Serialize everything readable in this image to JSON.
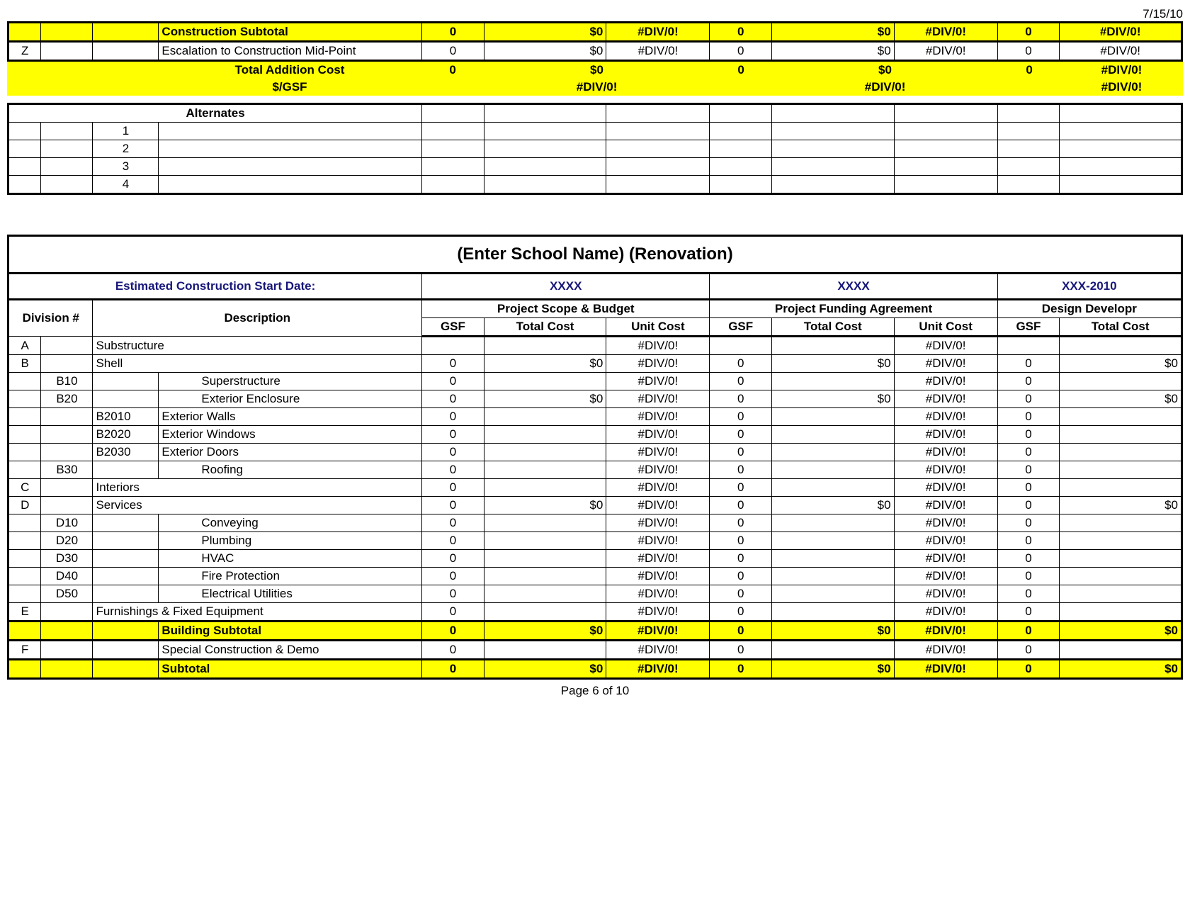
{
  "header_date": "7/15/10",
  "top": {
    "construction_subtotal": {
      "label": "Construction Subtotal",
      "v": [
        "0",
        "$0",
        "#DIV/0!",
        "0",
        "$0",
        "#DIV/0!",
        "0",
        "#DIV/0!"
      ]
    },
    "escalation": {
      "code": "Z",
      "label": "Escalation to Construction Mid-Point",
      "v": [
        "0",
        "$0",
        "#DIV/0!",
        "0",
        "$0",
        "#DIV/0!",
        "0",
        "#DIV/0!"
      ]
    },
    "total_addition": {
      "label": "Total Addition Cost",
      "v": [
        "0",
        "$0",
        "0",
        "$0",
        "0",
        "#DIV/0!"
      ]
    },
    "per_gsf": {
      "label": "$/GSF",
      "v": [
        "#DIV/0!",
        "#DIV/0!",
        "#DIV/0!"
      ]
    }
  },
  "alternates": {
    "header": "Alternates",
    "rows": [
      "1",
      "2",
      "3",
      "4"
    ]
  },
  "main": {
    "title": "(Enter School Name) (Renovation)",
    "start_label": "Estimated Construction Start Date:",
    "dates": [
      "XXXX",
      "XXXX",
      "XXX-2010"
    ],
    "groups": [
      "Project Scope & Budget",
      "Project Funding Agreement",
      "Design Developr"
    ],
    "cols": {
      "div": "Division #",
      "desc": "Description",
      "gsf": "GSF",
      "tc": "Total Cost",
      "uc": "Unit Cost"
    },
    "rows": [
      {
        "a": "A",
        "b": "",
        "c": "",
        "d": "Substructure",
        "ind": 0,
        "v": [
          "",
          "",
          "#DIV/0!",
          "",
          "",
          "#DIV/0!",
          "",
          ""
        ]
      },
      {
        "a": "B",
        "b": "",
        "c": "",
        "d": "Shell",
        "ind": 0,
        "v": [
          "0",
          "$0",
          "#DIV/0!",
          "0",
          "$0",
          "#DIV/0!",
          "0",
          "$0"
        ]
      },
      {
        "a": "",
        "b": "B10",
        "c": "",
        "d": "Superstructure",
        "ind": 2,
        "v": [
          "0",
          "",
          "#DIV/0!",
          "0",
          "",
          "#DIV/0!",
          "0",
          ""
        ]
      },
      {
        "a": "",
        "b": "B20",
        "c": "",
        "d": "Exterior Enclosure",
        "ind": 2,
        "v": [
          "0",
          "$0",
          "#DIV/0!",
          "0",
          "$0",
          "#DIV/0!",
          "0",
          "$0"
        ]
      },
      {
        "a": "",
        "b": "",
        "c": "B2010",
        "d": "Exterior Walls",
        "ind": 1,
        "v": [
          "0",
          "",
          "#DIV/0!",
          "0",
          "",
          "#DIV/0!",
          "0",
          ""
        ]
      },
      {
        "a": "",
        "b": "",
        "c": "B2020",
        "d": "Exterior Windows",
        "ind": 1,
        "v": [
          "0",
          "",
          "#DIV/0!",
          "0",
          "",
          "#DIV/0!",
          "0",
          ""
        ]
      },
      {
        "a": "",
        "b": "",
        "c": "B2030",
        "d": "Exterior Doors",
        "ind": 1,
        "v": [
          "0",
          "",
          "#DIV/0!",
          "0",
          "",
          "#DIV/0!",
          "0",
          ""
        ]
      },
      {
        "a": "",
        "b": "B30",
        "c": "",
        "d": "Roofing",
        "ind": 2,
        "v": [
          "0",
          "",
          "#DIV/0!",
          "0",
          "",
          "#DIV/0!",
          "0",
          ""
        ]
      },
      {
        "a": "C",
        "b": "",
        "c": "",
        "d": "Interiors",
        "ind": 0,
        "v": [
          "0",
          "",
          "#DIV/0!",
          "0",
          "",
          "#DIV/0!",
          "0",
          ""
        ]
      },
      {
        "a": "D",
        "b": "",
        "c": "",
        "d": "Services",
        "ind": 0,
        "v": [
          "0",
          "$0",
          "#DIV/0!",
          "0",
          "$0",
          "#DIV/0!",
          "0",
          "$0"
        ]
      },
      {
        "a": "",
        "b": "D10",
        "c": "",
        "d": "Conveying",
        "ind": 2,
        "v": [
          "0",
          "",
          "#DIV/0!",
          "0",
          "",
          "#DIV/0!",
          "0",
          ""
        ]
      },
      {
        "a": "",
        "b": "D20",
        "c": "",
        "d": "Plumbing",
        "ind": 2,
        "v": [
          "0",
          "",
          "#DIV/0!",
          "0",
          "",
          "#DIV/0!",
          "0",
          ""
        ]
      },
      {
        "a": "",
        "b": "D30",
        "c": "",
        "d": "HVAC",
        "ind": 2,
        "v": [
          "0",
          "",
          "#DIV/0!",
          "0",
          "",
          "#DIV/0!",
          "0",
          ""
        ]
      },
      {
        "a": "",
        "b": "D40",
        "c": "",
        "d": "Fire Protection",
        "ind": 2,
        "v": [
          "0",
          "",
          "#DIV/0!",
          "0",
          "",
          "#DIV/0!",
          "0",
          ""
        ]
      },
      {
        "a": "",
        "b": "D50",
        "c": "",
        "d": "Electrical Utilities",
        "ind": 2,
        "v": [
          "0",
          "",
          "#DIV/0!",
          "0",
          "",
          "#DIV/0!",
          "0",
          ""
        ]
      },
      {
        "a": "E",
        "b": "",
        "c": "",
        "d": "Furnishings & Fixed Equipment",
        "ind": 0,
        "v": [
          "0",
          "",
          "#DIV/0!",
          "0",
          "",
          "#DIV/0!",
          "0",
          ""
        ]
      }
    ],
    "building_subtotal": {
      "label": "Building Subtotal",
      "v": [
        "0",
        "$0",
        "#DIV/0!",
        "0",
        "$0",
        "#DIV/0!",
        "0",
        "$0"
      ]
    },
    "special": {
      "a": "F",
      "label": "Special Construction & Demo",
      "v": [
        "0",
        "",
        "#DIV/0!",
        "0",
        "",
        "#DIV/0!",
        "0",
        ""
      ]
    },
    "subtotal": {
      "label": "Subtotal",
      "v": [
        "0",
        "$0",
        "#DIV/0!",
        "0",
        "$0",
        "#DIV/0!",
        "0",
        "$0"
      ]
    }
  },
  "footer": "Page 6 of 10"
}
